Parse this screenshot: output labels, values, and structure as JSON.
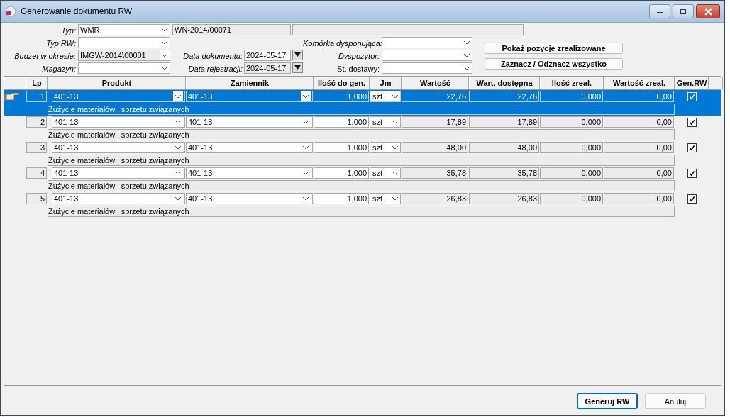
{
  "window": {
    "title": "Generowanie dokumentu RW"
  },
  "form": {
    "typ": {
      "label": "Typ:",
      "value": "WMR"
    },
    "numer": "WN-2014/00071",
    "typ_rw": {
      "label": "Typ RW:"
    },
    "budzet": {
      "label": "Budżet w okresie:",
      "value": "IMGW-2014\\00001"
    },
    "magazyn": {
      "label": "Magazyn:"
    },
    "data_dokumentu": {
      "label": "Data dokumentu:",
      "value": "2024-05-17"
    },
    "data_rejestracji": {
      "label": "Data rejestracji:",
      "value": "2024-05-17"
    },
    "komorka": {
      "label": "Komórka dysponująca:"
    },
    "dyspozytor": {
      "label": "Dyspozytor:"
    },
    "st_dostawy": {
      "label": "St. dostawy:"
    },
    "buttons": [
      "Pokaż pozycje zrealizowane",
      "Zaznacz / Odznacz wszystko"
    ]
  },
  "table": {
    "columns": [
      "Lp",
      "Produkt",
      "Zamiennik",
      "Ilość do gen.",
      "Jm",
      "Wartość",
      "Wart. dostępna",
      "Ilość zreal.",
      "Wartość zreal.",
      "Gen.RW"
    ],
    "rows": [
      {
        "lp": "1",
        "produkt": "401-13",
        "zamiennik": "401-13",
        "ilosc": "1,000",
        "jm": "szt",
        "wartosc": "22,76",
        "wart_dostepna": "22,76",
        "ilosc_zreal": "0,000",
        "wartosc_zreal": "0,00",
        "gen_rw": true,
        "opis": "Zużycie materiałów i sprzetu związanych",
        "selected": true
      },
      {
        "lp": "2",
        "produkt": "401-13",
        "zamiennik": "401-13",
        "ilosc": "1,000",
        "jm": "szt",
        "wartosc": "17,89",
        "wart_dostepna": "17,89",
        "ilosc_zreal": "0,000",
        "wartosc_zreal": "0,00",
        "gen_rw": true,
        "opis": "Zużycie materiałów i sprzetu związanych",
        "selected": false
      },
      {
        "lp": "3",
        "produkt": "401-13",
        "zamiennik": "401-13",
        "ilosc": "1,000",
        "jm": "szt",
        "wartosc": "48,00",
        "wart_dostepna": "48,00",
        "ilosc_zreal": "0,000",
        "wartosc_zreal": "0,00",
        "gen_rw": true,
        "opis": "Zużycie materiałów i sprzetu związanych",
        "selected": false
      },
      {
        "lp": "4",
        "produkt": "401-13",
        "zamiennik": "401-13",
        "ilosc": "1,000",
        "jm": "szt",
        "wartosc": "35,78",
        "wart_dostepna": "35,78",
        "ilosc_zreal": "0,000",
        "wartosc_zreal": "0,00",
        "gen_rw": true,
        "opis": "Zużycie materiałów i sprzetu związanych",
        "selected": false
      },
      {
        "lp": "5",
        "produkt": "401-13",
        "zamiennik": "401-13",
        "ilosc": "1,000",
        "jm": "szt",
        "wartosc": "26,83",
        "wart_dostepna": "26,83",
        "ilosc_zreal": "0,000",
        "wartosc_zreal": "0,00",
        "gen_rw": true,
        "opis": "Zużycie materiałów i sprzetu związanych",
        "selected": false
      }
    ]
  },
  "footer": {
    "buttons": [
      "Generuj RW",
      "Anuluj"
    ]
  }
}
